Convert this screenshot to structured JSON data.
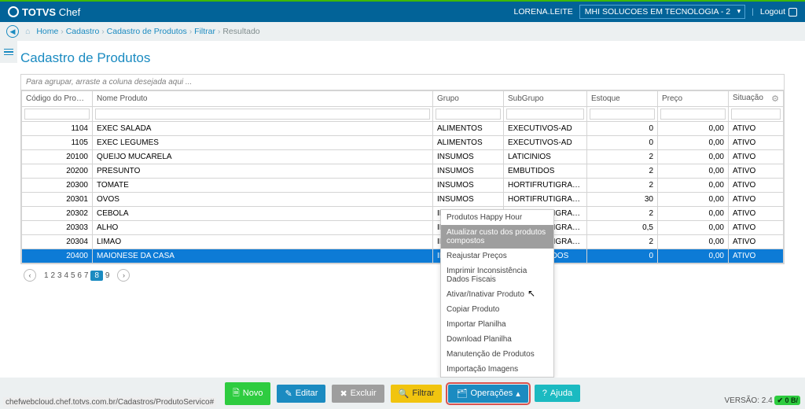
{
  "brand": {
    "bold": "TOTVS",
    "light": "Chef"
  },
  "top": {
    "user": "LORENA.LEITE",
    "tenant": "MHI SOLUCOES EM TECNOLOGIA - 2",
    "logout": "Logout"
  },
  "breadcrumb": {
    "items": [
      "Home",
      "Cadastro",
      "Cadastro de Produtos",
      "Filtrar"
    ],
    "current": "Resultado"
  },
  "title": "Cadastro de Produtos",
  "grid": {
    "group_hint": "Para agrupar, arraste a coluna desejada aqui ...",
    "columns": [
      "Código do Produto",
      "Nome Produto",
      "Grupo",
      "SubGrupo",
      "Estoque",
      "Preço",
      "Situação"
    ],
    "rows": [
      {
        "codigo": "1104",
        "nome": "EXEC SALADA",
        "grupo": "ALIMENTOS",
        "sub": "EXECUTIVOS-AD",
        "estoque": "0",
        "preco": "0,00",
        "sit": "ATIVO"
      },
      {
        "codigo": "1105",
        "nome": "EXEC LEGUMES",
        "grupo": "ALIMENTOS",
        "sub": "EXECUTIVOS-AD",
        "estoque": "0",
        "preco": "0,00",
        "sit": "ATIVO"
      },
      {
        "codigo": "20100",
        "nome": "QUEIJO MUCARELA",
        "grupo": "INSUMOS",
        "sub": "LATICINIOS",
        "estoque": "2",
        "preco": "0,00",
        "sit": "ATIVO"
      },
      {
        "codigo": "20200",
        "nome": "PRESUNTO",
        "grupo": "INSUMOS",
        "sub": "EMBUTIDOS",
        "estoque": "2",
        "preco": "0,00",
        "sit": "ATIVO"
      },
      {
        "codigo": "20300",
        "nome": "TOMATE",
        "grupo": "INSUMOS",
        "sub": "HORTIFRUTIGRANJEIROS",
        "estoque": "2",
        "preco": "0,00",
        "sit": "ATIVO"
      },
      {
        "codigo": "20301",
        "nome": "OVOS",
        "grupo": "INSUMOS",
        "sub": "HORTIFRUTIGRANJEIROS",
        "estoque": "30",
        "preco": "0,00",
        "sit": "ATIVO"
      },
      {
        "codigo": "20302",
        "nome": "CEBOLA",
        "grupo": "INSUMOS",
        "sub": "HORTIFRUTIGRANJEIROS",
        "estoque": "2",
        "preco": "0,00",
        "sit": "ATIVO"
      },
      {
        "codigo": "20303",
        "nome": "ALHO",
        "grupo": "INSUMOS",
        "sub": "HORTIFRUTIGRANJEIROS",
        "estoque": "0,5",
        "preco": "0,00",
        "sit": "ATIVO"
      },
      {
        "codigo": "20304",
        "nome": "LIMAO",
        "grupo": "INSUMOS",
        "sub": "HORTIFRUTIGRANJEIROS",
        "estoque": "2",
        "preco": "0,00",
        "sit": "ATIVO"
      },
      {
        "codigo": "20400",
        "nome": "MAIONESE DA CASA",
        "grupo": "INSUMOS",
        "sub": "PROCESSADOS",
        "estoque": "0",
        "preco": "0,00",
        "sit": "ATIVO",
        "selected": true
      }
    ]
  },
  "pager": {
    "pages": [
      "1",
      "2",
      "3",
      "4",
      "5",
      "6",
      "7",
      "8",
      "9"
    ],
    "active": "8"
  },
  "footer": {
    "novo": "Novo",
    "editar": "Editar",
    "excluir": "Excluir",
    "filtrar": "Filtrar",
    "operacoes": "Operações",
    "ajuda": "Ajuda"
  },
  "ops_menu": [
    "Produtos Happy Hour",
    "Atualizar custo dos produtos compostos",
    "Reajustar Preços",
    "Imprimir Inconsistência Dados Fiscais",
    "Ativar/Inativar Produto",
    "Copiar Produto",
    "Importar Planilha",
    "Download Planilha",
    "Manutenção de Produtos",
    "Importação Imagens"
  ],
  "ops_menu_hl": 1,
  "version": {
    "label": "VERSÃO: 2.4",
    "tag": "✔ 0 B/"
  },
  "status_url": "chefwebcloud.chef.totvs.com.br/Cadastros/ProdutoServico#"
}
